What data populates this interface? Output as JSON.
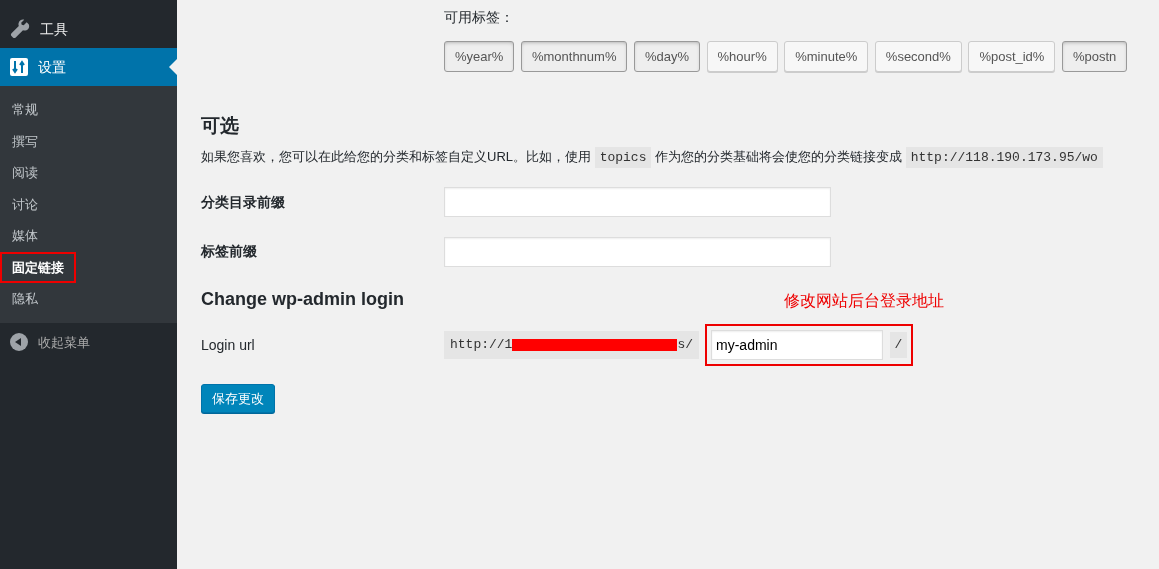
{
  "sidebar": {
    "menu": [
      {
        "label": "工具",
        "selected": false
      },
      {
        "label": "设置",
        "selected": true
      }
    ],
    "submenu": [
      {
        "label": "常规",
        "selected": false,
        "highlighted": false
      },
      {
        "label": "撰写",
        "selected": false,
        "highlighted": false
      },
      {
        "label": "阅读",
        "selected": false,
        "highlighted": false
      },
      {
        "label": "讨论",
        "selected": false,
        "highlighted": false
      },
      {
        "label": "媒体",
        "selected": false,
        "highlighted": false
      },
      {
        "label": "固定链接",
        "selected": true,
        "highlighted": true
      },
      {
        "label": "隐私",
        "selected": false,
        "highlighted": false
      }
    ],
    "collapse": "收起菜单"
  },
  "tags": {
    "label": "可用标签：",
    "items": [
      {
        "label": "%year%",
        "selected": true
      },
      {
        "label": "%monthnum%",
        "selected": true
      },
      {
        "label": "%day%",
        "selected": true
      },
      {
        "label": "%hour%",
        "selected": false
      },
      {
        "label": "%minute%",
        "selected": false
      },
      {
        "label": "%second%",
        "selected": false
      },
      {
        "label": "%post_id%",
        "selected": false
      },
      {
        "label": "%postn",
        "selected": true
      }
    ]
  },
  "optional": {
    "heading": "可选",
    "intro": [
      {
        "kind": "text",
        "text": "如果您喜欢，您可以在此给您的分类和标签自定义URL。比如，使用"
      },
      {
        "kind": "code",
        "text": "topics"
      },
      {
        "kind": "text",
        "text": "作为您的分类基础将会使您的分类链接变成"
      },
      {
        "kind": "code",
        "text": "http://118.190.173.95/wo"
      }
    ],
    "fields": [
      {
        "label": "分类目录前缀"
      },
      {
        "label": "标签前缀"
      }
    ]
  },
  "login": {
    "heading": "Change wp-admin login",
    "annotation": "修改网站后台登录地址",
    "label": "Login url",
    "prefix": "http://1",
    "suffix": "s/",
    "redacted": true,
    "value": "my-admin",
    "end": "/",
    "highlighted": true
  },
  "save_button": "保存更改"
}
